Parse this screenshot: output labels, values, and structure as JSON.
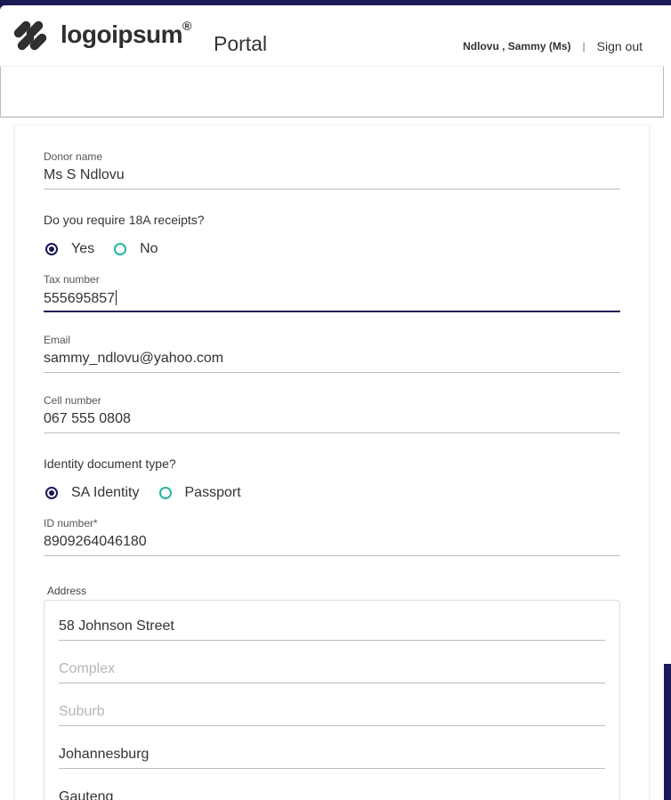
{
  "header": {
    "logo_text": "logoipsum",
    "logo_registered": "®",
    "portal_title": "Portal",
    "user_name": "Ndlovu , Sammy (Ms)",
    "separator": "|",
    "sign_out": "Sign out"
  },
  "form": {
    "donor_name": {
      "label": "Donor name",
      "value": "Ms S Ndlovu"
    },
    "receipts_question": "Do you require 18A receipts?",
    "receipts_options": [
      {
        "label": "Yes",
        "checked": true
      },
      {
        "label": "No",
        "checked": false
      }
    ],
    "tax_number": {
      "label": "Tax number",
      "value": "555695857"
    },
    "email": {
      "label": "Email",
      "value": "sammy_ndlovu@yahoo.com"
    },
    "cell_number": {
      "label": "Cell number",
      "value": "067 555 0808"
    },
    "id_type_question": "Identity document type?",
    "id_type_options": [
      {
        "label": "SA Identity",
        "checked": true
      },
      {
        "label": "Passport",
        "checked": false
      }
    ],
    "id_number": {
      "label": "ID number*",
      "value": "8909264046180"
    },
    "address": {
      "legend": "Address",
      "street": "58 Johnson Street",
      "complex_placeholder": "Complex",
      "suburb_placeholder": "Suburb",
      "city": "Johannesburg",
      "province": "Gauteng"
    }
  },
  "colors": {
    "brand_navy": "#1c1a55",
    "radio_teal": "#26b5a1"
  },
  "icons": {
    "logo": "logoipsum-mark-icon"
  }
}
